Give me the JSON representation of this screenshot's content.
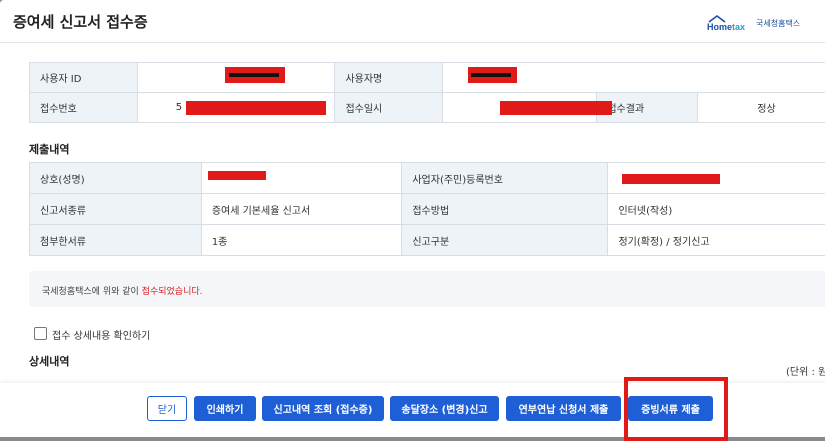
{
  "window": {
    "title": "증여세 신고서 접수증",
    "logo_text": "국세청홈택스"
  },
  "receipt_info": {
    "user_id_label": "사용자 ID",
    "user_name_label": "사용자명",
    "receipt_no_label": "접수번호",
    "receipt_no_prefix": "5",
    "receipt_time_label": "접수일시",
    "result_label": "접수결과",
    "result_value": "정상"
  },
  "submission": {
    "title": "제출내역",
    "rows": [
      {
        "l1": "상호(성명)",
        "v1": "",
        "l2": "사업자(주민)등록번호",
        "v2": ""
      },
      {
        "l1": "신고서종류",
        "v1": "증여세 기본세율 신고서",
        "l2": "접수방법",
        "v2": "인터넷(작성)"
      },
      {
        "l1": "첨부한서류",
        "v1": "1종",
        "l2": "신고구분",
        "v2": "정기(확정) / 정기신고"
      }
    ]
  },
  "notice": {
    "prefix": "국세청홈택스에 위와 같이 ",
    "highlight": "접수되었습니다."
  },
  "detail": {
    "checkbox_label": "접수 상세내용 확인하기",
    "title": "상세내역",
    "unit": "(단위 : 원)"
  },
  "buttons": {
    "close": "닫기",
    "print": "인쇄하기",
    "history": "신고내역 조회 (접수증)",
    "delivery": "송달장소 (변경)신고",
    "installment": "연부연납 신청서 제출",
    "evidence": "증빙서류 제출"
  },
  "colors": {
    "primary": "#1f5fd6",
    "header_cell": "#eef3f7",
    "redaction": "#e01919",
    "notice_highlight": "#d62020"
  }
}
